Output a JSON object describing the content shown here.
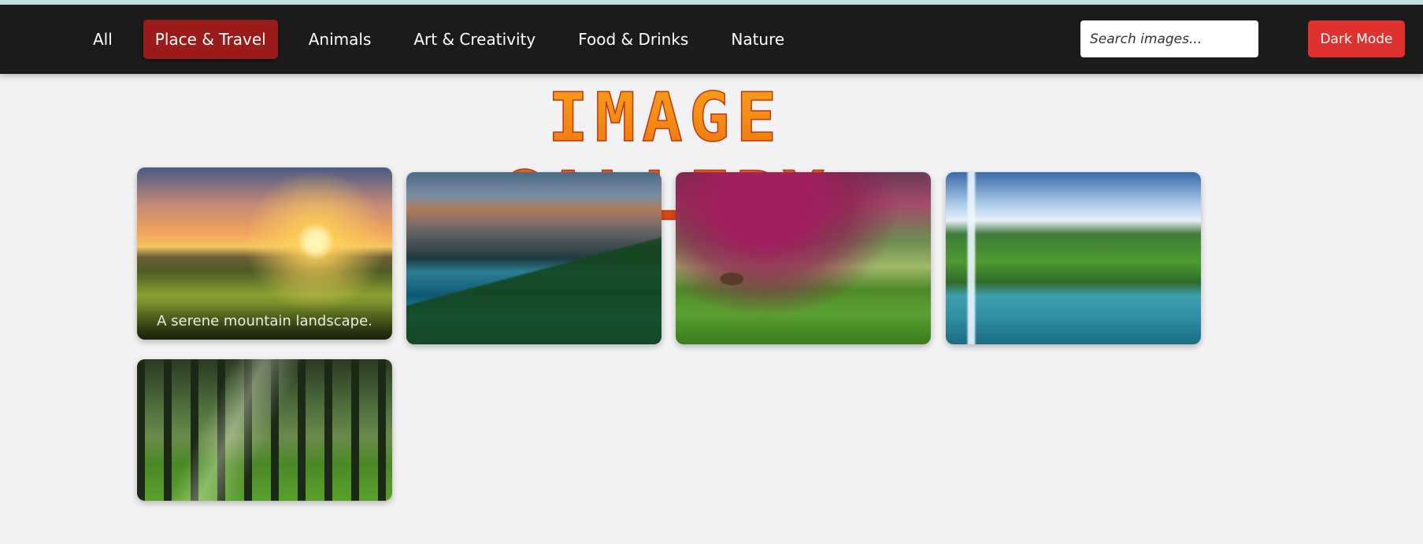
{
  "nav": {
    "items": [
      {
        "label": "All",
        "active": false
      },
      {
        "label": "Place & Travel",
        "active": true
      },
      {
        "label": "Animals",
        "active": false
      },
      {
        "label": "Art & Creativity",
        "active": false
      },
      {
        "label": "Food & Drinks",
        "active": false
      },
      {
        "label": "Nature",
        "active": false
      }
    ],
    "search": {
      "placeholder": "Search images...",
      "value": ""
    },
    "dark_mode_label": "Dark Mode"
  },
  "page": {
    "title": "IMAGE GALLERY"
  },
  "gallery": {
    "images": [
      {
        "subject": "sunset-mountain-landscape",
        "caption": "A serene mountain landscape."
      },
      {
        "subject": "mountain-lake-reflection",
        "caption": ""
      },
      {
        "subject": "blossom-tree-meadow",
        "caption": ""
      },
      {
        "subject": "waterfall-lake",
        "caption": ""
      },
      {
        "subject": "sunlit-forest",
        "caption": ""
      }
    ]
  },
  "colors": {
    "navbar_bg": "#1b1b1b",
    "active_nav_bg": "#9b1b1b",
    "dark_mode_button_bg": "#e03131",
    "title_gradient_top": "#f7a21b",
    "title_gradient_bottom": "#d4331a",
    "page_bg": "#f2f2f2"
  }
}
